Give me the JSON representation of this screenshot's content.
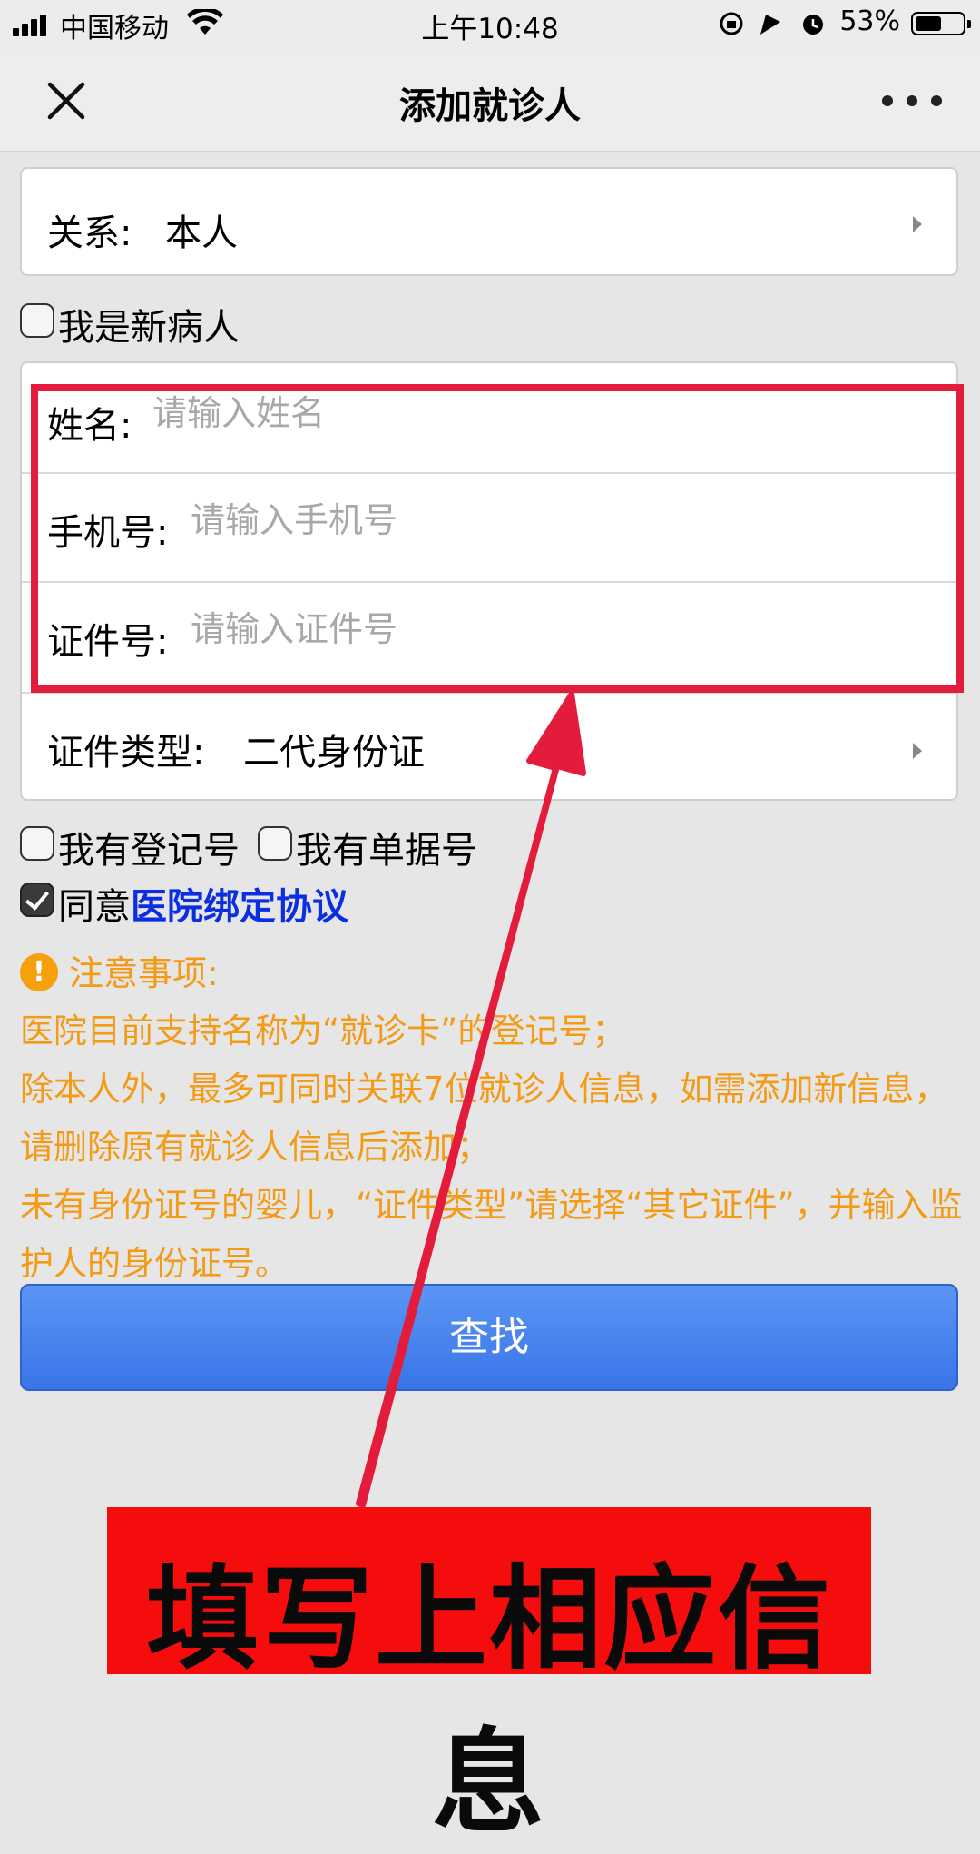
{
  "status_bar": {
    "carrier": "中国移动",
    "time": "上午10:48",
    "battery": "53%"
  },
  "nav": {
    "title": "添加就诊人",
    "close_icon": "close-icon",
    "more_icon": "more-icon"
  },
  "relation": {
    "label": "关系:",
    "value": "本人"
  },
  "new_patient_checkbox": {
    "label": "我是新病人",
    "checked": false
  },
  "form": {
    "name": {
      "label": "姓名:",
      "placeholder": "请输入姓名"
    },
    "phone": {
      "label": "手机号:",
      "placeholder": "请输入手机号"
    },
    "id_number": {
      "label": "证件号:",
      "placeholder": "请输入证件号"
    },
    "id_type": {
      "label": "证件类型:",
      "value": "二代身份证"
    }
  },
  "options": {
    "has_registration": "我有登记号",
    "has_receipt": "我有单据号",
    "agree_prefix": "同意",
    "agree_link": "医院绑定协议",
    "agree_checked": true
  },
  "notice": {
    "title": "注意事项:",
    "lines": [
      "医院目前支持名称为“就诊卡”的登记号；",
      "除本人外，最多可同时关联7位就诊人信息，如需添加新信息，请删除原有就诊人信息后添加；",
      "未有身份证号的婴儿，“证件类型”请选择“其它证件”，并输入监护人的身份证号。"
    ]
  },
  "search_button": "查找",
  "annotation": {
    "banner_text": "填写上相应信息"
  },
  "colors": {
    "accent_blue": "#3975e7",
    "notice_orange": "#f39a16",
    "annotation_red": "#e41c3c"
  }
}
